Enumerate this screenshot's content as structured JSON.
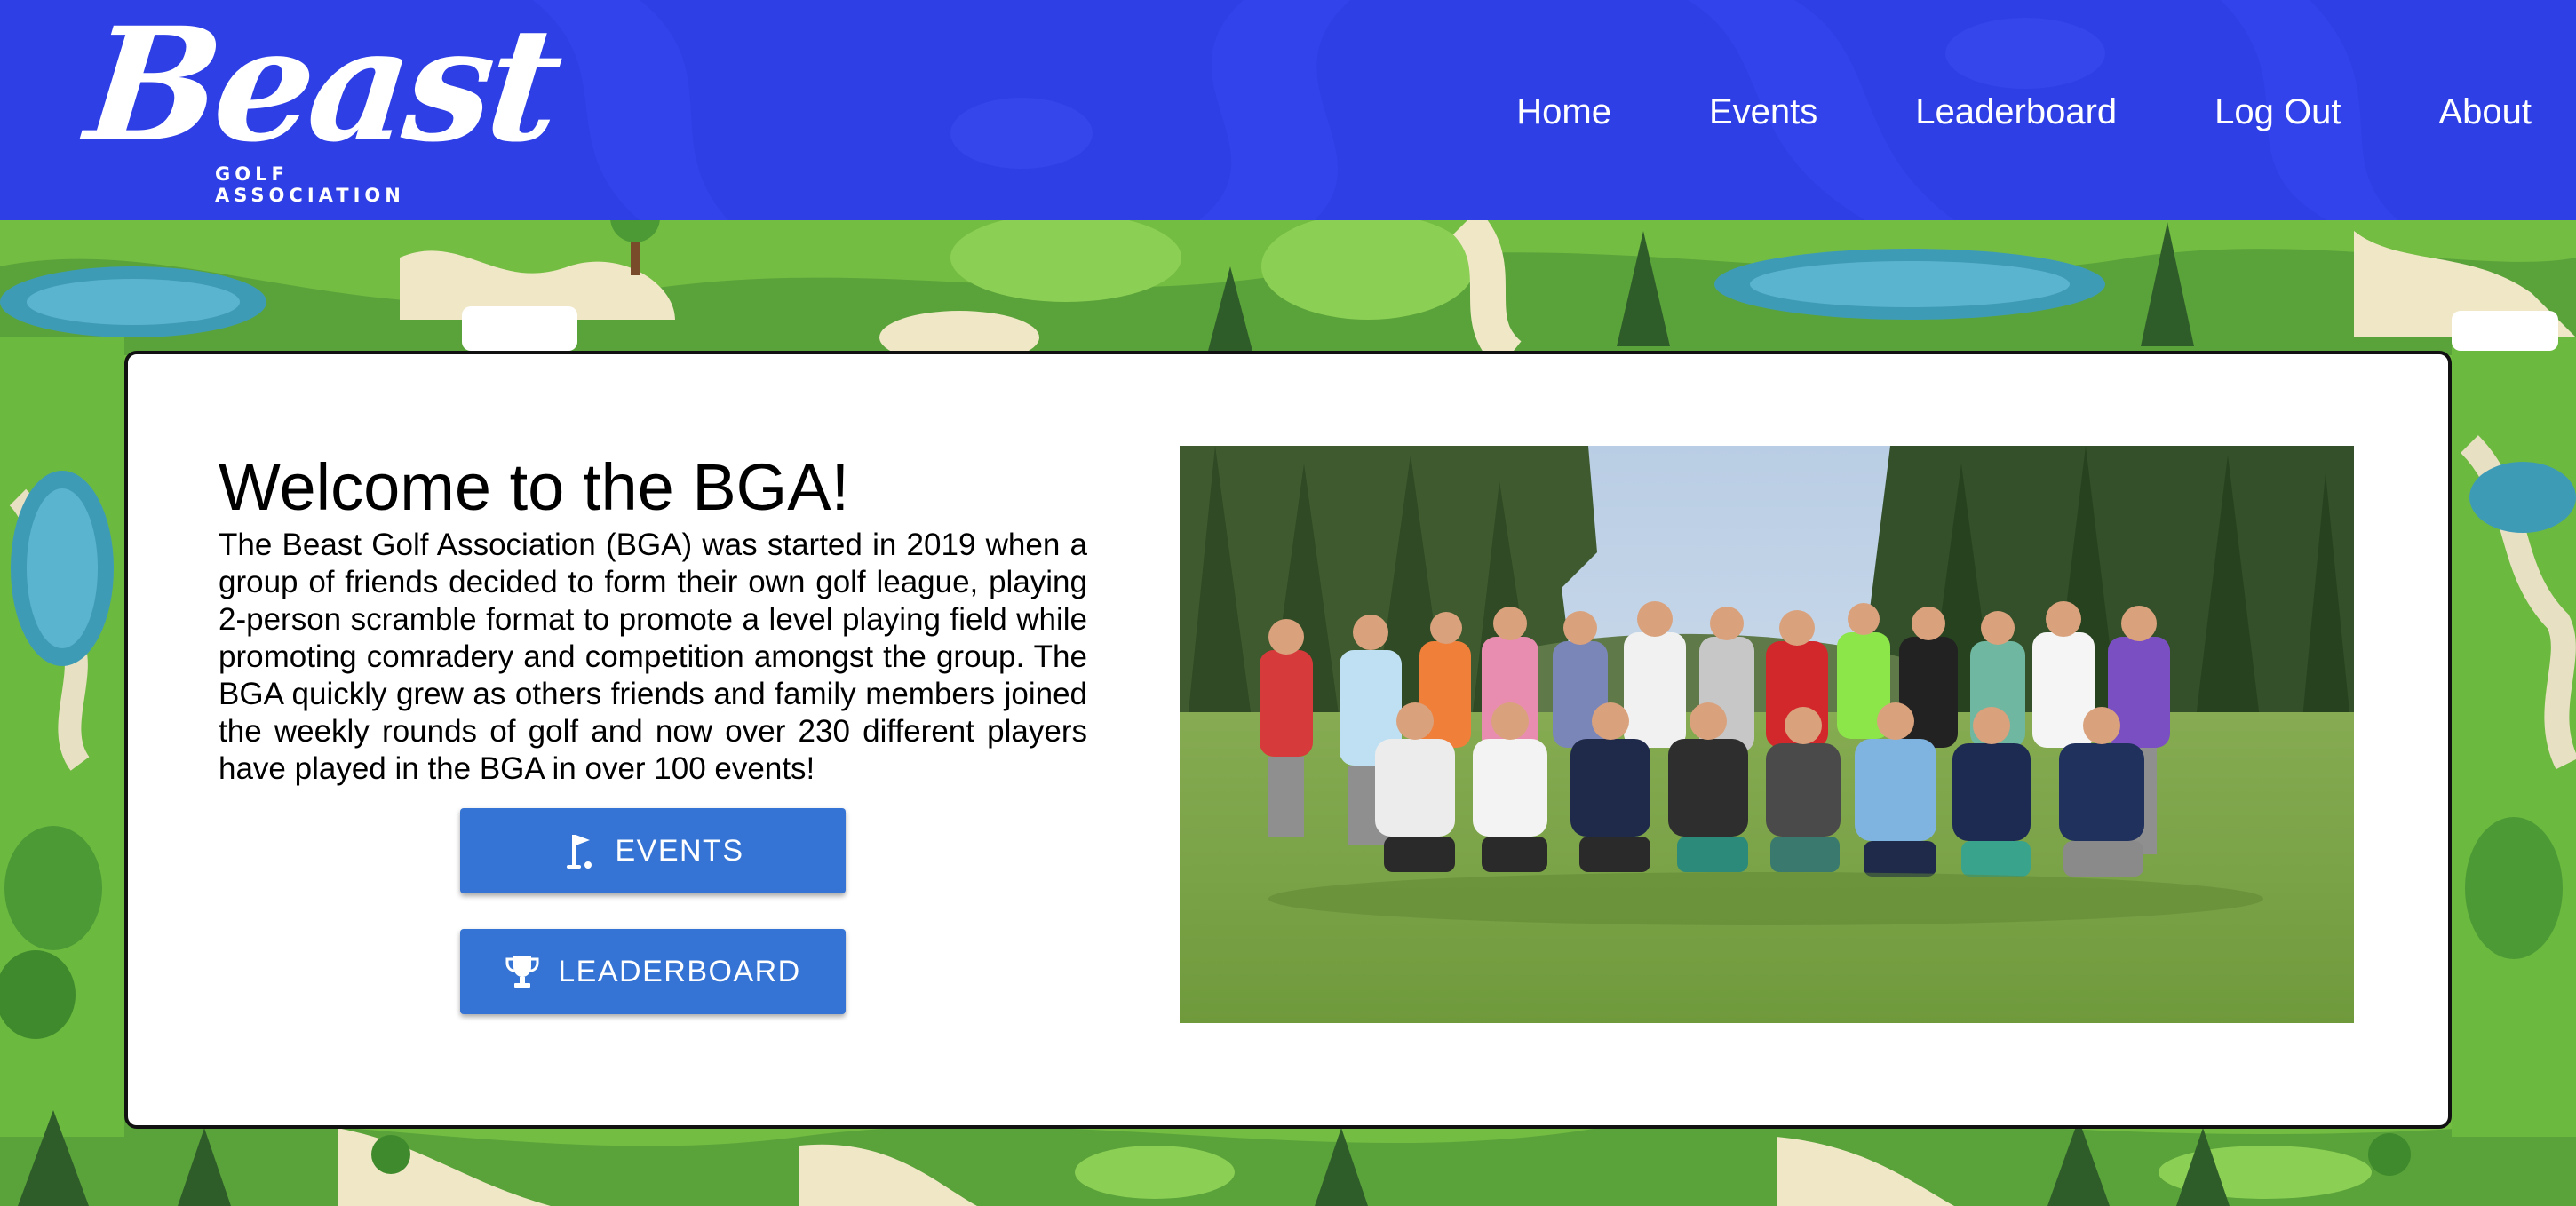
{
  "brand": {
    "logo_word": "Beast",
    "logo_sub": "GOLF ASSOCIATION"
  },
  "nav": {
    "items": [
      "Home",
      "Events",
      "Leaderboard",
      "Log Out",
      "About"
    ]
  },
  "intro": {
    "title": "Welcome to the BGA!",
    "body": "The Beast Golf Association (BGA) was started in 2019 when a group of friends decided to form their own golf league, playing 2-person scramble format to promote a level playing field while promoting comradery and competition amongst the group. The BGA quickly grew as others friends and family members joined the weekly rounds of golf and now over 230 different players have played in the BGA in over 100 events!"
  },
  "buttons": {
    "events_label": "EVENTS",
    "events_icon": "golf-flag-icon",
    "leaderboard_label": "LEADERBOARD",
    "leaderboard_icon": "trophy-icon"
  },
  "colors": {
    "header": "#2e3fe6",
    "button": "#3574d4",
    "background_grass": "#6fb83f"
  }
}
